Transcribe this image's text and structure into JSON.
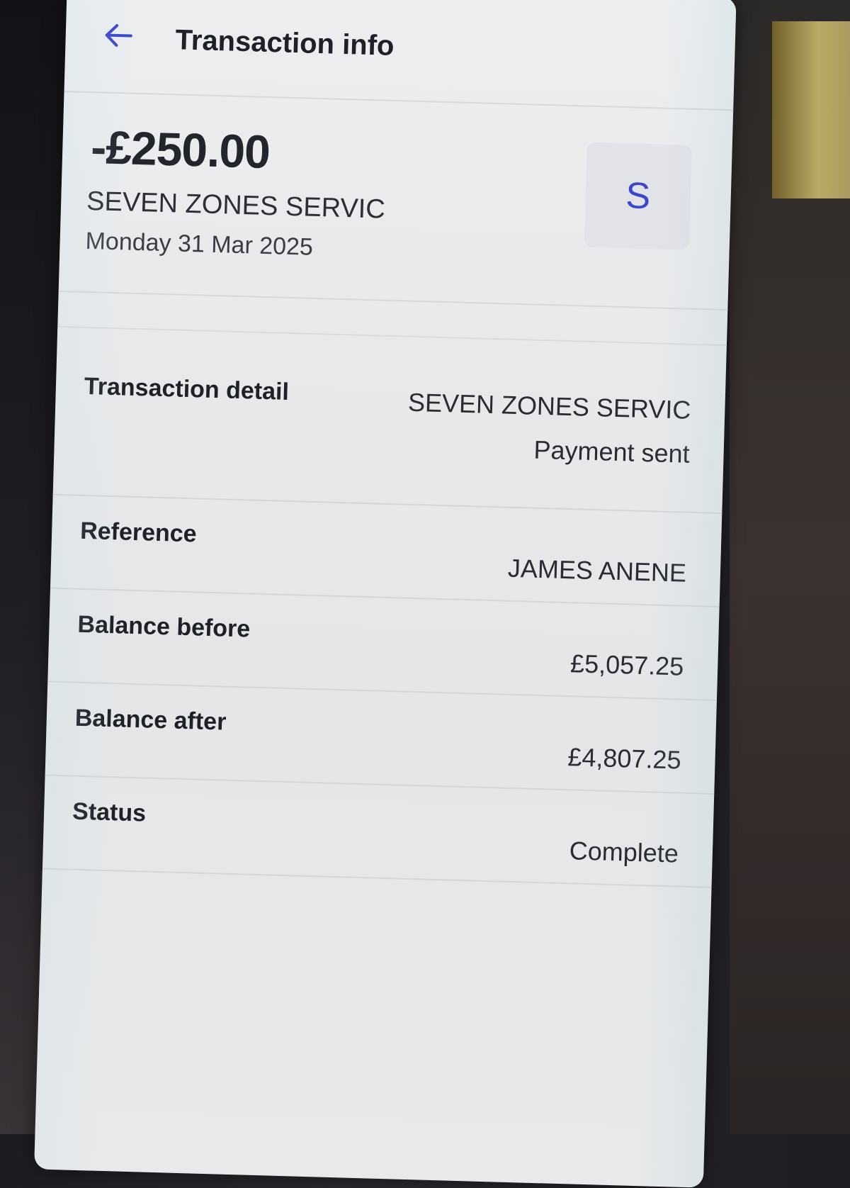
{
  "header": {
    "title": "Transaction info"
  },
  "summary": {
    "amount": "-£250.00",
    "merchant": "SEVEN ZONES SERVIC",
    "date": "Monday 31 Mar 2025",
    "avatar_letter": "S"
  },
  "details": {
    "transaction_detail": {
      "label": "Transaction detail",
      "value": "SEVEN ZONES SERVIC",
      "subvalue": "Payment sent"
    },
    "reference": {
      "label": "Reference",
      "value": "JAMES ANENE"
    },
    "balance_before": {
      "label": "Balance before",
      "value": "£5,057.25"
    },
    "balance_after": {
      "label": "Balance after",
      "value": "£4,807.25"
    },
    "status": {
      "label": "Status",
      "value": "Complete"
    }
  },
  "icons": {
    "back": "arrow-left-icon"
  },
  "colors": {
    "accent": "#3a46cc",
    "text_primary": "#1f2129",
    "screen_bg": "#e8e9eb"
  }
}
